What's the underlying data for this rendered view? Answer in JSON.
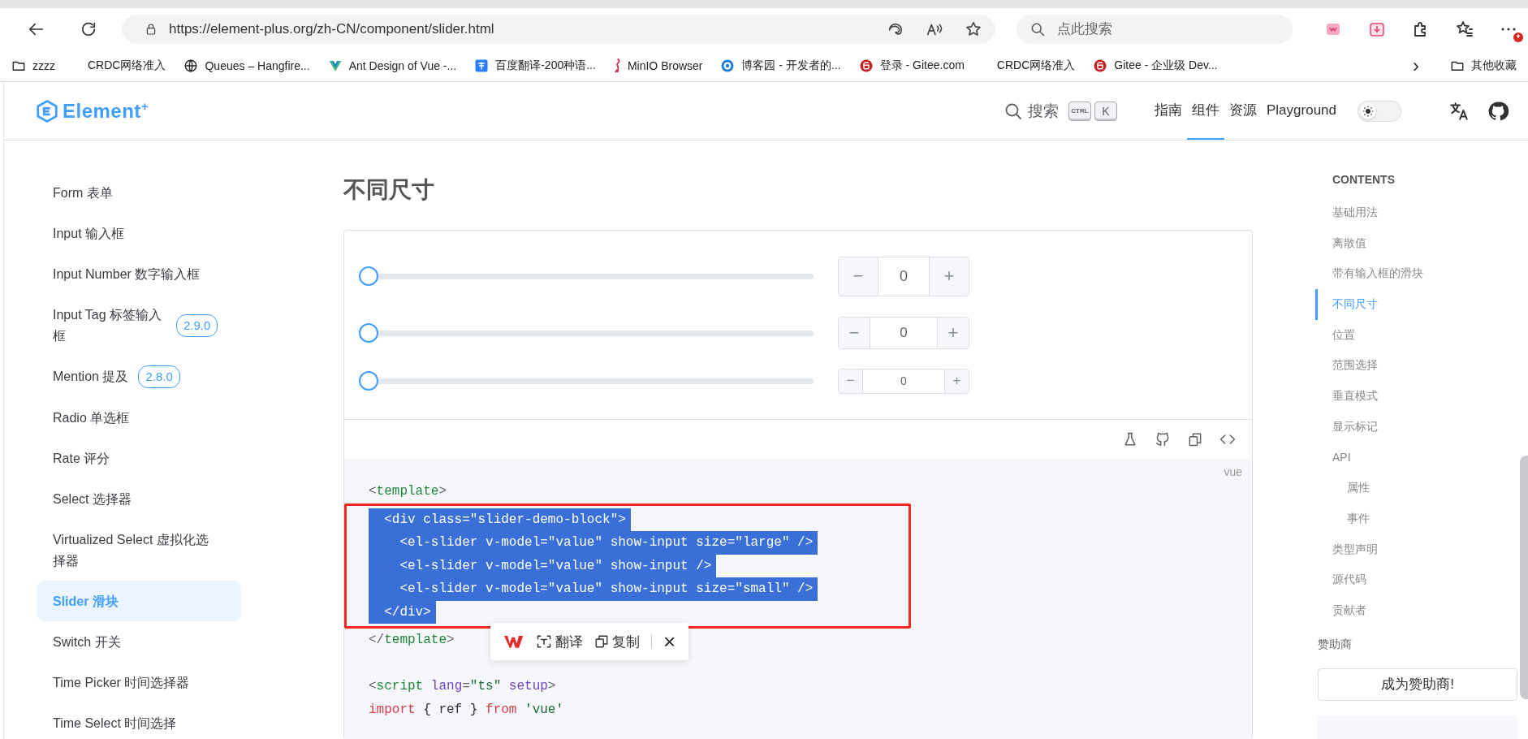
{
  "browser": {
    "url": "https://element-plus.org/zh-CN/component/slider.html",
    "search": {
      "placeholder": "点此搜索"
    },
    "bookmarks": [
      {
        "label": "zzzz",
        "kind": "folder"
      },
      {
        "label": "CRDC网络准入",
        "kind": "blank"
      },
      {
        "label": "Queues – Hangfire...",
        "kind": "globe"
      },
      {
        "label": "Ant Design of Vue -...",
        "kind": "antd"
      },
      {
        "label": "百度翻译-200种语...",
        "kind": "translate"
      },
      {
        "label": "MinIO Browser",
        "kind": "minio"
      },
      {
        "label": "博客园 - 开发者的...",
        "kind": "blog"
      },
      {
        "label": "登录 - Gitee.com",
        "kind": "gitee"
      },
      {
        "label": "CRDC网络准入",
        "kind": "blank"
      },
      {
        "label": "Gitee - 企业级 Dev...",
        "kind": "gitee"
      }
    ],
    "more_bookmarks": "›",
    "other_bookmarks": "其他收藏"
  },
  "header": {
    "logo": "Element$^{+}$",
    "search": "搜索",
    "keys": [
      "CTRL",
      "K"
    ],
    "nav": [
      {
        "label": "指南",
        "selected": false
      },
      {
        "label": "组件",
        "selected": true
      },
      {
        "label": "资源",
        "selected": false
      },
      {
        "label": "Playground",
        "selected": false
      }
    ],
    "dark_mode": false
  },
  "sidebar": {
    "items": [
      {
        "label": "Form 表单",
        "selected": false
      },
      {
        "label": "Input 输入框",
        "selected": false
      },
      {
        "label": "Input Number 数字输入框",
        "selected": false
      },
      {
        "label": "Input Tag 标签输入框",
        "badge": "2.9.0",
        "selected": false
      },
      {
        "label": "Mention 提及",
        "badge": "2.8.0",
        "selected": false
      },
      {
        "label": "Radio 单选框",
        "selected": false
      },
      {
        "label": "Rate 评分",
        "selected": false
      },
      {
        "label": "Select 选择器",
        "selected": false
      },
      {
        "label": "Virtualized Select 虚拟化选择器",
        "selected": false
      },
      {
        "label": "Slider 滑块",
        "selected": true
      },
      {
        "label": "Switch 开关",
        "selected": false
      },
      {
        "label": "Time Picker 时间选择器",
        "selected": false
      },
      {
        "label": "Time Select 时间选择",
        "selected": false
      }
    ]
  },
  "main": {
    "title": "不同尺寸",
    "sliders": [
      {
        "kind": "large",
        "level": 0,
        "value": "0",
        "minus": "−",
        "plus": "+"
      },
      {
        "kind": "default",
        "level": 0,
        "value": "0",
        "minus": "−",
        "plus": "+"
      },
      {
        "kind": "small",
        "level": 0,
        "value": "0",
        "minus": "−",
        "plus": "+"
      }
    ],
    "code": {
      "language": "vue",
      "lines": [
        {
          "selected": false,
          "tokens": [
            {
              "text": "<",
              "kind": "punct"
            },
            {
              "text": "template",
              "kind": "tag"
            },
            {
              "text": ">",
              "kind": "punct"
            }
          ]
        },
        {
          "selected": true,
          "tokens": [
            {
              "text": "  <div class=\"slider-demo-block\">",
              "kind": "plain"
            }
          ]
        },
        {
          "selected": true,
          "tokens": [
            {
              "text": "    <el-slider v-model=\"value\" show-input size=\"large\" />",
              "kind": "plain"
            }
          ]
        },
        {
          "selected": true,
          "tokens": [
            {
              "text": "    <el-slider v-model=\"value\" show-input />",
              "kind": "plain"
            }
          ]
        },
        {
          "selected": true,
          "tokens": [
            {
              "text": "    <el-slider v-model=\"value\" show-input size=\"small\" />",
              "kind": "plain"
            }
          ]
        },
        {
          "selected": true,
          "tokens": [
            {
              "text": "  </div>",
              "kind": "plain"
            }
          ]
        },
        {
          "selected": false,
          "tokens": [
            {
              "text": "</",
              "kind": "punct"
            },
            {
              "text": "template",
              "kind": "tag"
            },
            {
              "text": ">",
              "kind": "punct"
            }
          ]
        },
        {
          "selected": false
        },
        {
          "selected": false,
          "tokens": [
            {
              "text": "<",
              "kind": "punct"
            },
            {
              "text": "script",
              "kind": "tag"
            },
            {
              "text": " lang",
              "kind": "attr"
            },
            {
              "text": "=",
              "kind": "punct"
            },
            {
              "text": "\"ts\"",
              "kind": "string"
            },
            {
              "text": " setup",
              "kind": "attr"
            },
            {
              "text": ">",
              "kind": "punct"
            }
          ]
        },
        {
          "selected": false,
          "tokens": [
            {
              "text": "import",
              "kind": "keyword"
            },
            {
              "text": " { ref } ",
              "kind": "plain"
            },
            {
              "text": "from",
              "kind": "keyword"
            },
            {
              "text": " 'vue'",
              "kind": "string"
            }
          ]
        }
      ]
    },
    "popup": {
      "translate": "翻译",
      "copy": "复制",
      "close": "×"
    }
  },
  "toc": {
    "heading": "CONTENTS",
    "items": [
      {
        "label": "基础用法",
        "selected": false
      },
      {
        "label": "离散值",
        "selected": false
      },
      {
        "label": "带有输入框的滑块",
        "selected": false
      },
      {
        "label": "不同尺寸",
        "selected": true
      },
      {
        "label": "位置",
        "selected": false
      },
      {
        "label": "范围选择",
        "selected": false
      },
      {
        "label": "垂直模式",
        "selected": false
      },
      {
        "label": "显示标记",
        "selected": false
      },
      {
        "label": "API",
        "selected": false,
        "children": [
          {
            "label": "属性",
            "selected": false
          },
          {
            "label": "事件",
            "selected": false
          }
        ]
      },
      {
        "label": "类型声明",
        "selected": false
      },
      {
        "label": "源代码",
        "selected": false
      },
      {
        "label": "贡献者",
        "selected": false
      }
    ],
    "sponsor_title": "赞助商",
    "sponsor_button": "成为赞助商!"
  }
}
